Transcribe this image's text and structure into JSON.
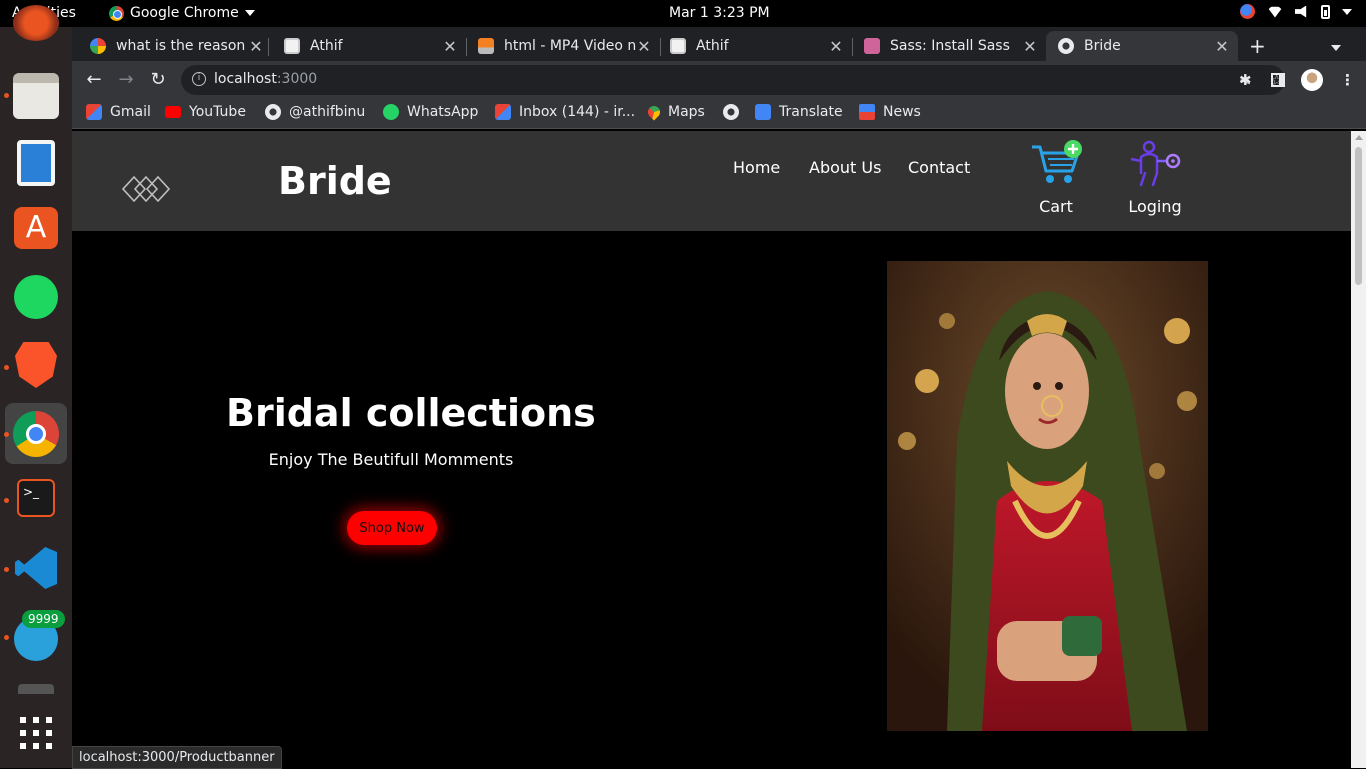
{
  "system": {
    "activities": "Activities",
    "app_name": "Google Chrome",
    "clock": "Mar 1   3:23 PM"
  },
  "dock": {
    "telegram_badge": "9999"
  },
  "tabs": [
    {
      "title": "what is the reason",
      "favicon": "google-icon"
    },
    {
      "title": "Athif",
      "favicon": "avatar-icon"
    },
    {
      "title": "html - MP4 Video n",
      "favicon": "stackoverflow-icon"
    },
    {
      "title": "Athif",
      "favicon": "avatar-icon"
    },
    {
      "title": "Sass: Install Sass",
      "favicon": "sass-icon"
    },
    {
      "title": "Bride",
      "favicon": "globe-icon",
      "active": true
    }
  ],
  "omnibox": {
    "host": "localhost",
    "port": ":3000"
  },
  "bookmarks": [
    {
      "label": "Gmail",
      "icon": "gmail-icon"
    },
    {
      "label": "YouTube",
      "icon": "youtube-icon"
    },
    {
      "label": "@athifbinu",
      "icon": "globe-icon"
    },
    {
      "label": "WhatsApp",
      "icon": "whatsapp-icon"
    },
    {
      "label": "Inbox (144) - ir...",
      "icon": "gmail-icon"
    },
    {
      "label": "Maps",
      "icon": "maps-icon"
    },
    {
      "label": "",
      "icon": "globe-icon"
    },
    {
      "label": "Translate",
      "icon": "translate-icon"
    },
    {
      "label": "News",
      "icon": "news-icon"
    }
  ],
  "site": {
    "brand": "Bride",
    "nav": [
      "Home",
      "About Us",
      "Contact"
    ],
    "cart_label": "Cart",
    "login_label": "Loging",
    "hero_title": "Bridal collections",
    "hero_subtitle": "Enjoy The Beutifull Momments",
    "shop_button": "Shop Now"
  },
  "status_url": "localhost:3000/Productbanner",
  "colors": {
    "accent_red": "#ff0000",
    "header_bg": "#333334",
    "cart_blue": "#29a3e8",
    "login_purple": "#6a3de8"
  }
}
